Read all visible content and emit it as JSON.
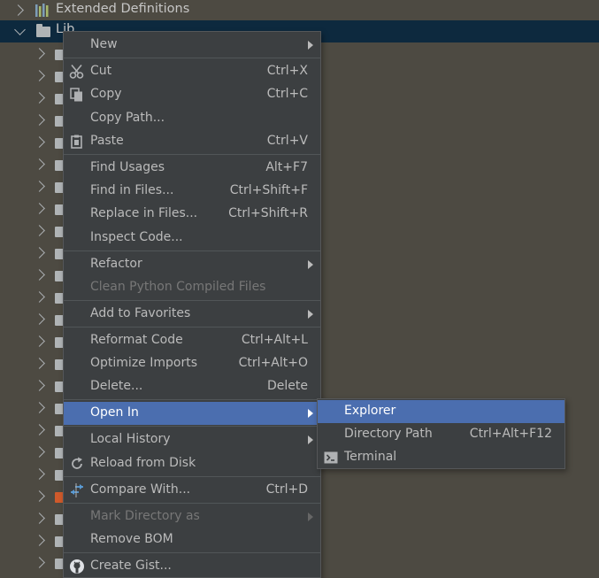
{
  "tree": {
    "top_item": "Extended Definitions",
    "selected_item": "Lib"
  },
  "menu": {
    "items": [
      {
        "label": "New",
        "shortcut": ""
      },
      {
        "label": "Cut",
        "shortcut": "Ctrl+X",
        "icon": "scissors-icon"
      },
      {
        "label": "Copy",
        "shortcut": "Ctrl+C",
        "icon": "copy-icon"
      },
      {
        "label": "Copy Path...",
        "shortcut": ""
      },
      {
        "label": "Paste",
        "shortcut": "Ctrl+V",
        "icon": "clipboard-icon"
      },
      {
        "label": "Find Usages",
        "shortcut": "Alt+F7"
      },
      {
        "label": "Find in Files...",
        "shortcut": "Ctrl+Shift+F"
      },
      {
        "label": "Replace in Files...",
        "shortcut": "Ctrl+Shift+R"
      },
      {
        "label": "Inspect Code...",
        "shortcut": ""
      },
      {
        "label": "Refactor",
        "shortcut": ""
      },
      {
        "label": "Clean Python Compiled Files",
        "shortcut": ""
      },
      {
        "label": "Add to Favorites",
        "shortcut": ""
      },
      {
        "label": "Reformat Code",
        "shortcut": "Ctrl+Alt+L"
      },
      {
        "label": "Optimize Imports",
        "shortcut": "Ctrl+Alt+O"
      },
      {
        "label": "Delete...",
        "shortcut": "Delete"
      },
      {
        "label": "Open In",
        "shortcut": ""
      },
      {
        "label": "Local History",
        "shortcut": ""
      },
      {
        "label": "Reload from Disk",
        "shortcut": "",
        "icon": "reload-icon"
      },
      {
        "label": "Compare With...",
        "shortcut": "Ctrl+D",
        "icon": "compare-icon"
      },
      {
        "label": "Mark Directory as",
        "shortcut": ""
      },
      {
        "label": "Remove BOM",
        "shortcut": ""
      },
      {
        "label": "Create Gist...",
        "shortcut": "",
        "icon": "github-icon"
      }
    ]
  },
  "submenu": {
    "items": [
      {
        "label": "Explorer",
        "shortcut": ""
      },
      {
        "label": "Directory Path",
        "shortcut": "Ctrl+Alt+F12"
      },
      {
        "label": "Terminal",
        "shortcut": "",
        "icon": "terminal-icon"
      }
    ]
  },
  "colors": {
    "background": "#4d4a42",
    "menu_bg": "#3c3f41",
    "highlight": "#4b6eaf",
    "selected_row": "#0d293e",
    "text": "#bbbbbb",
    "disabled_text": "#777777"
  }
}
